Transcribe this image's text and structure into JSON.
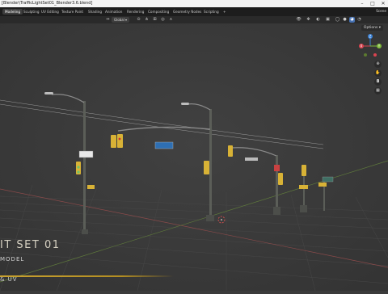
{
  "window": {
    "title": "[Blender\\TrafficLightSet01_Blender3.6.blend]"
  },
  "menubar": {
    "tabs": [
      "Modeling",
      "Sculpting",
      "UV Editing",
      "Texture Paint",
      "Shading",
      "Animation",
      "Rendering",
      "Compositing",
      "Geometry Nodes",
      "Scripting",
      "+"
    ],
    "active_tab": "Modeling",
    "scene_label": "Scene"
  },
  "header": {
    "transform_orientation": "Global"
  },
  "viewport": {
    "options_label": "Options",
    "gizmo": {
      "z": "Z",
      "y": "Y",
      "x": "X"
    }
  },
  "overlay": {
    "title": "IT SET 01",
    "subtitle": "MODEL",
    "bottom": "& UV"
  },
  "colors": {
    "accent": "#4772b3",
    "gold": "#c9a230",
    "gizmo_x": "#d9434f",
    "gizmo_y": "#7fbc3a",
    "gizmo_z": "#3b82d6"
  }
}
